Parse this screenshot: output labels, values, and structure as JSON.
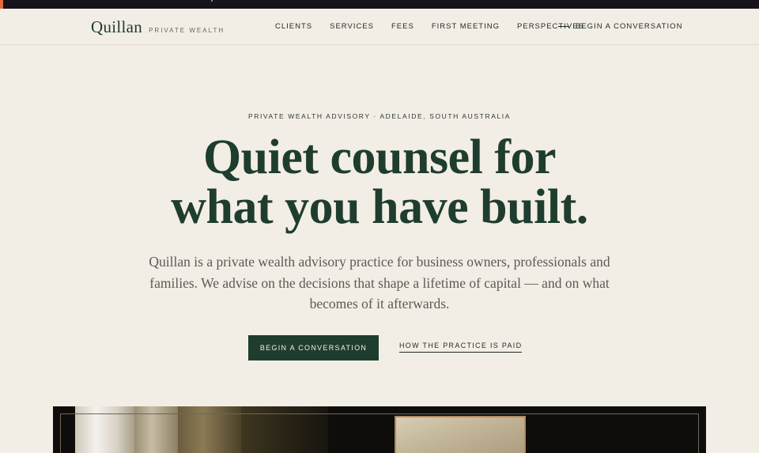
{
  "brand": {
    "name": "Quillan",
    "tagline": "PRIVATE WEALTH"
  },
  "nav": {
    "items": [
      "CLIENTS",
      "SERVICES",
      "FEES",
      "FIRST MEETING",
      "PERSPECTIVES"
    ],
    "cta_label": "BEGIN A CONVERSATION"
  },
  "hero": {
    "eyebrow": "PRIVATE WEALTH ADVISORY · ADELAIDE, SOUTH AUSTRALIA",
    "headline_line1": "Quiet counsel for",
    "headline_line2": "what you have built.",
    "lede": "Quillan is a private wealth advisory practice for business owners, professionals and families. We advise on the decisions that shape a lifetime of capital — and on what becomes of it afterwards.",
    "primary_button": "BEGIN A CONVERSATION",
    "secondary_link": "HOW THE PRACTICE IS PAID"
  },
  "colors": {
    "background": "#f2eee5",
    "brand_green": "#1f3d2f",
    "top_bar": "#16141a",
    "accent": "#e26a3c"
  }
}
